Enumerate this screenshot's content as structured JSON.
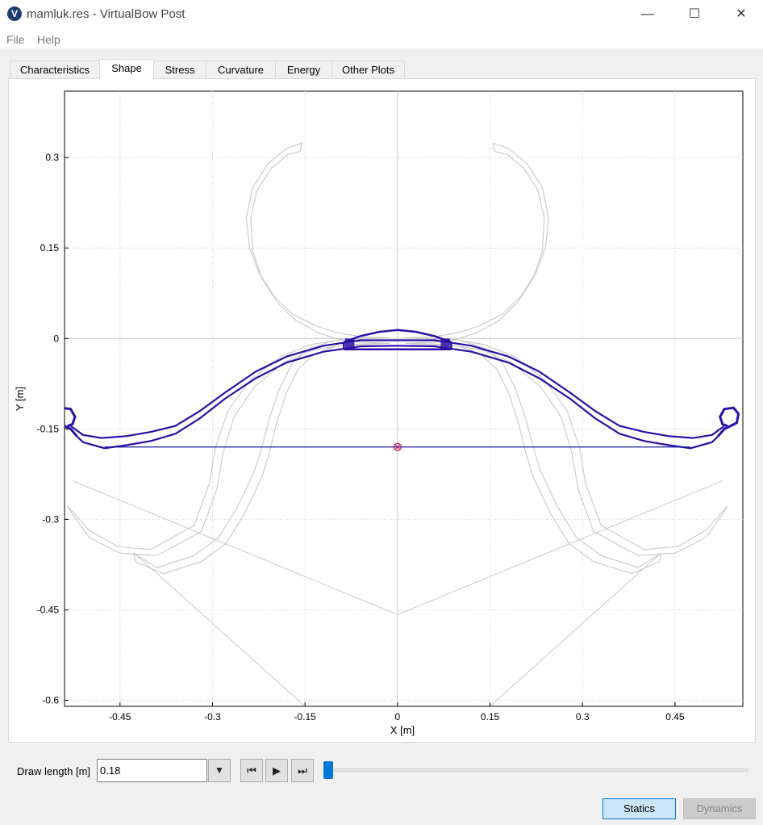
{
  "window": {
    "title": "mamluk.res - VirtualBow Post",
    "controls": {
      "minimize": "—",
      "maximize": "☐",
      "close": "✕"
    }
  },
  "menu": {
    "items": [
      "File",
      "Help"
    ]
  },
  "tabs": [
    "Characteristics",
    "Shape",
    "Stress",
    "Curvature",
    "Energy",
    "Other Plots"
  ],
  "active_tab": "Shape",
  "colors": {
    "current": "#2c0fa6",
    "ghost": "#c8c8c8",
    "string": "#1a1a9e",
    "marker": "#c2185b"
  },
  "chart_data": {
    "type": "line",
    "xlabel": "X [m]",
    "ylabel": "Y [m]",
    "xlim": [
      -0.54,
      0.56
    ],
    "ylim": [
      -0.61,
      0.41
    ],
    "xticks": [
      -0.45,
      -0.3,
      -0.15,
      0,
      0.15,
      0.3,
      0.45
    ],
    "xtick_labels": [
      "-0.45",
      "-0.3",
      "-0.15",
      "0",
      "0.15",
      "0.3",
      "0.45"
    ],
    "yticks": [
      0.3,
      0.15,
      0,
      -0.15,
      -0.3,
      -0.45,
      -0.6
    ],
    "ytick_labels": [
      "0.3",
      "0.15",
      "0",
      "-0.15",
      "-0.3",
      "-0.45",
      "-0.6"
    ],
    "grid": true,
    "ghost_outer": [
      [
        0.013,
        0.001
      ],
      [
        0.06,
        -0.001
      ],
      [
        0.1,
        -0.003
      ],
      [
        0.14,
        -0.01
      ],
      [
        0.19,
        -0.03
      ],
      [
        0.24,
        -0.07
      ],
      [
        0.275,
        -0.12
      ],
      [
        0.295,
        -0.18
      ],
      [
        0.305,
        -0.24
      ],
      [
        0.33,
        -0.31
      ],
      [
        0.4,
        -0.35
      ],
      [
        0.454,
        -0.345
      ],
      [
        0.5,
        -0.318
      ],
      [
        0.535,
        -0.278
      ]
    ],
    "ghost_outer_b": [
      [
        0.013,
        -0.008
      ],
      [
        0.06,
        -0.01
      ],
      [
        0.1,
        -0.013
      ],
      [
        0.14,
        -0.02
      ],
      [
        0.185,
        -0.04
      ],
      [
        0.232,
        -0.08
      ],
      [
        0.265,
        -0.13
      ],
      [
        0.283,
        -0.19
      ],
      [
        0.293,
        -0.25
      ],
      [
        0.318,
        -0.32
      ],
      [
        0.39,
        -0.36
      ],
      [
        0.45,
        -0.356
      ],
      [
        0.5,
        -0.33
      ],
      [
        0.528,
        -0.29
      ]
    ],
    "ghost_inner": [
      [
        0.013,
        0.001
      ],
      [
        0.06,
        0.0
      ],
      [
        0.1,
        -0.003
      ],
      [
        0.14,
        -0.015
      ],
      [
        0.17,
        -0.04
      ],
      [
        0.19,
        -0.08
      ],
      [
        0.207,
        -0.13
      ],
      [
        0.22,
        -0.18
      ],
      [
        0.232,
        -0.22
      ],
      [
        0.26,
        -0.28
      ],
      [
        0.29,
        -0.33
      ],
      [
        0.33,
        -0.36
      ],
      [
        0.39,
        -0.38
      ],
      [
        0.428,
        -0.356
      ]
    ],
    "ghost_inner_b": [
      [
        0.013,
        -0.008
      ],
      [
        0.06,
        -0.009
      ],
      [
        0.1,
        -0.013
      ],
      [
        0.135,
        -0.026
      ],
      [
        0.162,
        -0.052
      ],
      [
        0.18,
        -0.09
      ],
      [
        0.196,
        -0.14
      ],
      [
        0.208,
        -0.19
      ],
      [
        0.22,
        -0.23
      ],
      [
        0.248,
        -0.29
      ],
      [
        0.278,
        -0.34
      ],
      [
        0.318,
        -0.37
      ],
      [
        0.38,
        -0.39
      ],
      [
        0.425,
        -0.37
      ]
    ],
    "ghost_top": [
      [
        0.013,
        0.001
      ],
      [
        0.06,
        0.003
      ],
      [
        0.1,
        0.01
      ],
      [
        0.13,
        0.02
      ],
      [
        0.17,
        0.04
      ],
      [
        0.2,
        0.07
      ],
      [
        0.225,
        0.11
      ],
      [
        0.24,
        0.15
      ],
      [
        0.245,
        0.2
      ],
      [
        0.235,
        0.25
      ],
      [
        0.21,
        0.29
      ],
      [
        0.18,
        0.315
      ],
      [
        0.155,
        0.324
      ]
    ],
    "ghost_top_b": [
      [
        0.013,
        -0.008
      ],
      [
        0.06,
        -0.006
      ],
      [
        0.1,
        0.0
      ],
      [
        0.13,
        0.01
      ],
      [
        0.165,
        0.03
      ],
      [
        0.195,
        0.06
      ],
      [
        0.22,
        0.1
      ],
      [
        0.235,
        0.145
      ],
      [
        0.238,
        0.2
      ],
      [
        0.228,
        0.245
      ],
      [
        0.205,
        0.282
      ],
      [
        0.178,
        0.305
      ],
      [
        0.158,
        0.31
      ]
    ],
    "ghost_string_outer": [
      [
        -0.527,
        -0.236
      ],
      [
        0,
        -0.458
      ],
      [
        0.527,
        -0.236
      ]
    ],
    "ghost_string_inner": [
      [
        -0.427,
        -0.356
      ],
      [
        -0.15,
        -0.61
      ]
    ],
    "limb_outer": [
      [
        0.0,
        -0.003
      ],
      [
        0.06,
        -0.003
      ],
      [
        0.12,
        -0.012
      ],
      [
        0.18,
        -0.03
      ],
      [
        0.23,
        -0.055
      ],
      [
        0.28,
        -0.09
      ],
      [
        0.32,
        -0.12
      ],
      [
        0.36,
        -0.145
      ],
      [
        0.4,
        -0.155
      ],
      [
        0.44,
        -0.162
      ],
      [
        0.48,
        -0.165
      ],
      [
        0.51,
        -0.16
      ],
      [
        0.53,
        -0.145
      ]
    ],
    "limb_inner": [
      [
        0.0,
        -0.012
      ],
      [
        0.06,
        -0.013
      ],
      [
        0.12,
        -0.022
      ],
      [
        0.18,
        -0.04
      ],
      [
        0.23,
        -0.066
      ],
      [
        0.28,
        -0.1
      ],
      [
        0.32,
        -0.132
      ],
      [
        0.36,
        -0.158
      ],
      [
        0.4,
        -0.17
      ],
      [
        0.44,
        -0.177
      ],
      [
        0.475,
        -0.182
      ],
      [
        0.51,
        -0.172
      ],
      [
        0.52,
        -0.162
      ]
    ],
    "tip_curl": [
      [
        0.52,
        -0.162
      ],
      [
        0.53,
        -0.15
      ],
      [
        0.55,
        -0.14
      ],
      [
        0.553,
        -0.125
      ],
      [
        0.545,
        -0.115
      ],
      [
        0.53,
        -0.117
      ],
      [
        0.523,
        -0.13
      ],
      [
        0.527,
        -0.142
      ],
      [
        0.535,
        -0.145
      ]
    ],
    "riser_top": [
      [
        -0.087,
        -0.006
      ],
      [
        -0.06,
        0.004
      ],
      [
        -0.03,
        0.011
      ],
      [
        0.0,
        0.014
      ],
      [
        0.03,
        0.011
      ],
      [
        0.06,
        0.004
      ],
      [
        0.087,
        -0.006
      ]
    ],
    "riser_bottom_y": -0.018,
    "riser_x": 0.087,
    "string_y": -0.18,
    "string_x_end": 0.475,
    "arrow_point": [
      0,
      -0.18
    ],
    "draw_length_value": 0.18
  },
  "controls": {
    "draw_length_label": "Draw length [m]",
    "draw_length_value": "0.18",
    "combo_icon": "▼",
    "first_icon": "⏮",
    "play_icon": "▶",
    "last_icon": "⏭",
    "slider_fraction": 0.0,
    "statics_label": "Statics",
    "dynamics_label": "Dynamics"
  }
}
